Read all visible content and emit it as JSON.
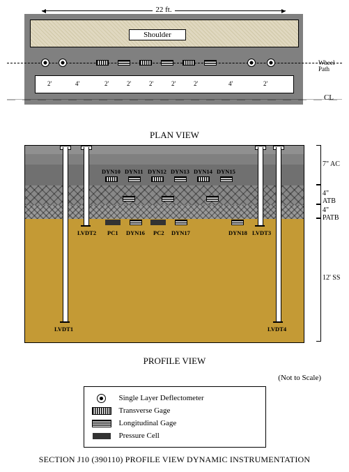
{
  "plan": {
    "top_dim": "22 ft.",
    "shoulder": "Shoulder",
    "wheel_path": "Wheel Path",
    "cl": "CL",
    "title": "PLAN VIEW",
    "segments": [
      "2'",
      "4'",
      "2'",
      "2'",
      "2'",
      "2'",
      "2'",
      "4'",
      "2'"
    ]
  },
  "profile": {
    "title": "PROFILE VIEW",
    "not_to_scale": "(Not to Scale)",
    "layers": {
      "ac": "7\" AC",
      "atb": "4\" ATB",
      "patb": "4\" PATB",
      "ss": "12' SS"
    },
    "dyn_top": [
      "DYN10",
      "DYN11",
      "DYN12",
      "DYN13",
      "DYN14",
      "DYN15"
    ],
    "bottom_labels": [
      "LVDT2",
      "PC1",
      "DYN16",
      "PC2",
      "DYN17",
      "DYN18",
      "LVDT3"
    ],
    "deep_labels": [
      "LVDT1",
      "LVDT4"
    ]
  },
  "legend": {
    "deflectometer": "Single Layer Deflectometer",
    "transverse": "Transverse Gage",
    "longitudinal": "Longitudinal Gage",
    "pressure": "Pressure Cell"
  },
  "footer": "SECTION J10 (390110) PROFILE VIEW DYNAMIC INSTRUMENTATION"
}
